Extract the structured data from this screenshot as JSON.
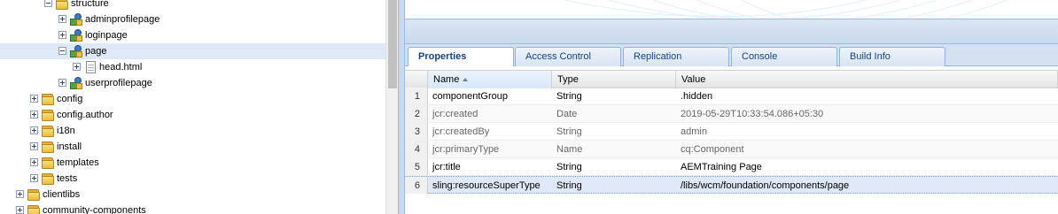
{
  "tree": {
    "nodes": [
      {
        "label": "structure",
        "icon": "folder",
        "toggle": "minus",
        "state": "normal"
      },
      {
        "label": "adminprofilepage",
        "icon": "component",
        "toggle": "plus",
        "state": "normal"
      },
      {
        "label": "loginpage",
        "icon": "component",
        "toggle": "plus",
        "state": "normal"
      },
      {
        "label": "page",
        "icon": "component",
        "toggle": "minus",
        "state": "selected"
      },
      {
        "label": "head.html",
        "icon": "file",
        "toggle": "plus",
        "state": "normal"
      },
      {
        "label": "userprofilepage",
        "icon": "component",
        "toggle": "plus",
        "state": "normal"
      },
      {
        "label": "config",
        "icon": "folder",
        "toggle": "plus",
        "state": "normal"
      },
      {
        "label": "config.author",
        "icon": "folder",
        "toggle": "plus",
        "state": "normal"
      },
      {
        "label": "i18n",
        "icon": "folder",
        "toggle": "plus",
        "state": "normal"
      },
      {
        "label": "install",
        "icon": "folder",
        "toggle": "plus",
        "state": "normal"
      },
      {
        "label": "templates",
        "icon": "folder",
        "toggle": "plus",
        "state": "normal"
      },
      {
        "label": "tests",
        "icon": "folder",
        "toggle": "plus",
        "state": "normal"
      },
      {
        "label": "clientlibs",
        "icon": "folder",
        "toggle": "plus",
        "state": "normal"
      },
      {
        "label": "community-components",
        "icon": "folder",
        "toggle": "plus",
        "state": "normal"
      }
    ]
  },
  "tabs": [
    {
      "label": "Properties",
      "active": true
    },
    {
      "label": "Access Control",
      "active": false
    },
    {
      "label": "Replication",
      "active": false
    },
    {
      "label": "Console",
      "active": false
    },
    {
      "label": "Build Info",
      "active": false
    }
  ],
  "grid": {
    "columns": {
      "name": "Name",
      "type": "Type",
      "value": "Value"
    },
    "sorted_column": "name",
    "rows": [
      {
        "n": "1",
        "name": "componentGroup",
        "type": "String",
        "value": ".hidden",
        "protected": false
      },
      {
        "n": "2",
        "name": "jcr:created",
        "type": "Date",
        "value": "2019-05-29T10:33:54.086+05:30",
        "protected": true
      },
      {
        "n": "3",
        "name": "jcr:createdBy",
        "type": "String",
        "value": "admin",
        "protected": true
      },
      {
        "n": "4",
        "name": "jcr:primaryType",
        "type": "Name",
        "value": "cq:Component",
        "protected": true
      },
      {
        "n": "5",
        "name": "jcr:title",
        "type": "String",
        "value": "AEMTraining Page",
        "protected": false
      },
      {
        "n": "6",
        "name": "sling:resourceSuperType",
        "type": "String",
        "value": "/libs/wcm/foundation/components/page",
        "protected": false
      }
    ]
  },
  "colors": {
    "selection": "#dfe8f6",
    "tab_text": "#15428b",
    "border": "#99bbe8"
  }
}
